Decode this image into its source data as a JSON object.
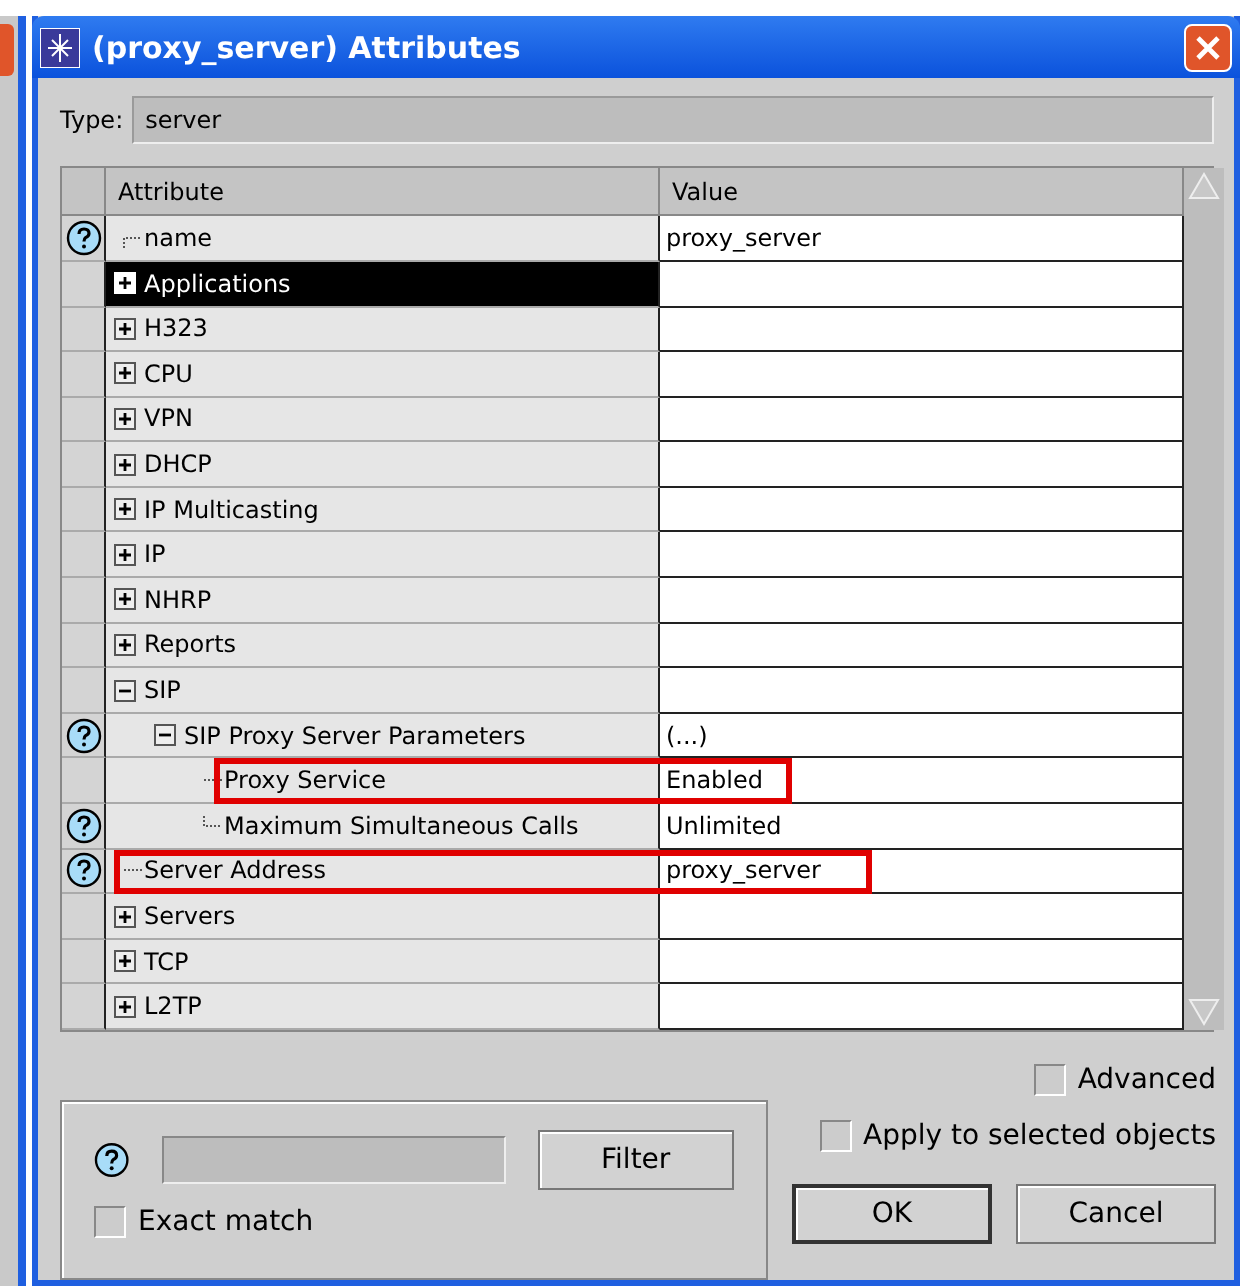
{
  "window": {
    "title": "(proxy_server) Attributes"
  },
  "type": {
    "label": "Type:",
    "value": "server"
  },
  "table": {
    "columns": [
      "Attribute",
      "Value"
    ],
    "rows": [
      {
        "kind": "leaf",
        "name": "name",
        "value": "proxy_server",
        "help": true,
        "selected": false,
        "highlighted": false
      },
      {
        "kind": "group",
        "name": "Applications",
        "help": false,
        "selected": true,
        "expanded": false,
        "highlighted": false
      },
      {
        "kind": "group",
        "name": "H323",
        "help": false,
        "selected": false,
        "expanded": false,
        "highlighted": false
      },
      {
        "kind": "group",
        "name": "CPU",
        "help": false,
        "selected": false,
        "expanded": false,
        "highlighted": false
      },
      {
        "kind": "group",
        "name": "VPN",
        "help": false,
        "selected": false,
        "expanded": false,
        "highlighted": false
      },
      {
        "kind": "group",
        "name": "DHCP",
        "help": false,
        "selected": false,
        "expanded": false,
        "highlighted": false
      },
      {
        "kind": "group",
        "name": "IP Multicasting",
        "help": false,
        "selected": false,
        "expanded": false,
        "highlighted": false
      },
      {
        "kind": "group",
        "name": "IP",
        "help": false,
        "selected": false,
        "expanded": false,
        "highlighted": false
      },
      {
        "kind": "group",
        "name": "NHRP",
        "help": false,
        "selected": false,
        "expanded": false,
        "highlighted": false
      },
      {
        "kind": "group",
        "name": "Reports",
        "help": false,
        "selected": false,
        "expanded": false,
        "highlighted": false
      },
      {
        "kind": "group",
        "name": "SIP",
        "help": false,
        "selected": false,
        "expanded": true,
        "highlighted": false,
        "children": [
          {
            "kind": "group",
            "name": "SIP Proxy Server Parameters",
            "value": "(...)",
            "help": true,
            "selected": false,
            "expanded": true,
            "highlighted": false,
            "children": [
              {
                "kind": "leaf",
                "name": "Proxy Service",
                "value": "Enabled",
                "help": false,
                "selected": false,
                "highlighted": true
              },
              {
                "kind": "leaf",
                "name": "Maximum Simultaneous Calls",
                "value": "Unlimited",
                "help": true,
                "selected": false,
                "highlighted": false
              }
            ]
          }
        ]
      },
      {
        "kind": "leaf",
        "name": "Server Address",
        "value": "proxy_server",
        "help": true,
        "selected": false,
        "highlighted": true
      },
      {
        "kind": "group",
        "name": "Servers",
        "help": false,
        "selected": false,
        "expanded": false,
        "highlighted": false
      },
      {
        "kind": "group",
        "name": "TCP",
        "help": false,
        "selected": false,
        "expanded": false,
        "highlighted": false
      },
      {
        "kind": "group",
        "name": "L2TP",
        "help": false,
        "selected": false,
        "expanded": false,
        "highlighted": false
      }
    ]
  },
  "filter": {
    "button": "Filter",
    "exact_match": {
      "label": "Exact match",
      "checked": false
    }
  },
  "advanced": {
    "label": "Advanced",
    "checked": false
  },
  "apply_to_selected": {
    "label": "Apply to selected objects",
    "checked": false
  },
  "buttons": [
    {
      "label": "OK",
      "default": true
    },
    {
      "label": "Cancel",
      "default": false
    }
  ]
}
